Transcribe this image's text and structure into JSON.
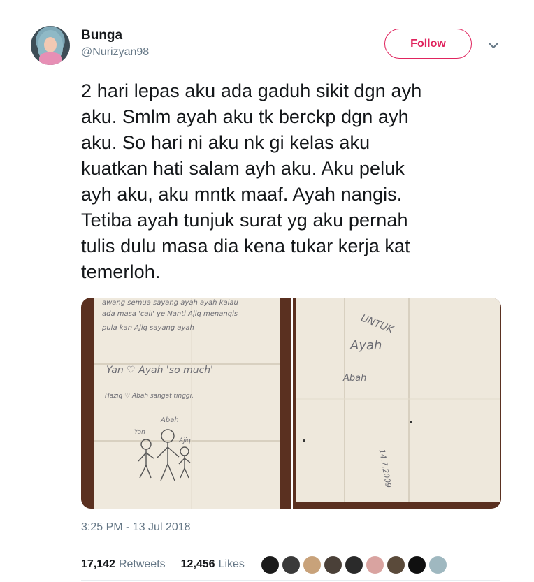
{
  "user": {
    "name": "Bunga",
    "handle": "@Nurizyan98",
    "follow_label": "Follow"
  },
  "tweet": {
    "text": "2 hari lepas aku ada gaduh sikit dgn ayh\naku. Smlm ayah aku tk berckp dgn ayh\naku. So hari ni aku nk gi kelas aku\nkuatkan hati salam ayh aku. Aku peluk\nayh aku, aku mntk maaf. Ayah nangis.\nTetiba ayah tunjuk surat yg aku pernah\ntulis dulu masa dia kena tukar kerja kat\ntemerloh.",
    "timestamp": "3:25 PM - 13 Jul 2018"
  },
  "photos": {
    "left_lines": {
      "l1": "awang semua sayang ayah ayah kalau",
      "l2": "ada masa 'call' ye Nanti Ajiq menangis",
      "l3": "pula kan Ajiq sayang ayah",
      "l4": "Yan ♡ Ayah 'so much'",
      "l5": "Haziq ♡ Abah sangat tinggi.",
      "abah": "Abah",
      "yan": "Yan",
      "ajiq": "Ajiq"
    },
    "right_lines": {
      "untuk": "UNTUK",
      "ayah": "Ayah",
      "abah": "Abah",
      "date": "14.7.2009"
    }
  },
  "stats": {
    "retweets_count": "17,142",
    "retweets_label": "Retweets",
    "likes_count": "12,456",
    "likes_label": "Likes"
  },
  "likers": [
    "#1b1b1b",
    "#3a3a3a",
    "#c8a27a",
    "#4a4038",
    "#2a2a2a",
    "#d9a3a0",
    "#5a4a3a",
    "#101010",
    "#9fb8c0"
  ],
  "colors": {
    "accent": "#e0245e",
    "secondary_text": "#657786"
  }
}
